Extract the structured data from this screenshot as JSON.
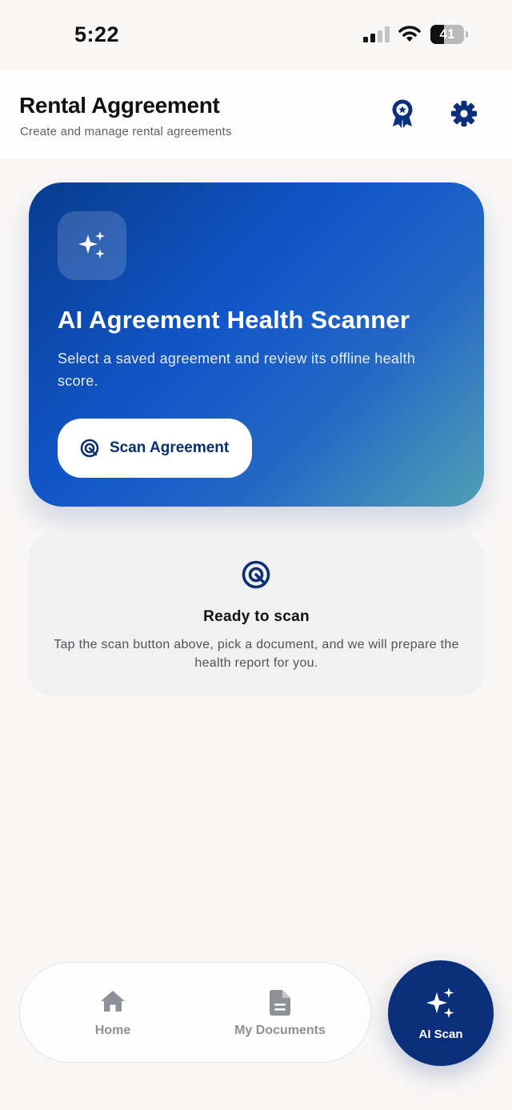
{
  "status_bar": {
    "time": "5:22",
    "battery_level": "41",
    "battery_fraction": 0.41,
    "signal_bars_active": 2,
    "signal_bars_total": 4
  },
  "header": {
    "title": "Rental Aggreement",
    "subtitle": "Create and manage rental agreements",
    "award_icon": "award-badge-icon",
    "settings_icon": "gear-icon"
  },
  "hero": {
    "icon": "sparkles-icon",
    "title": "AI Agreement Health Scanner",
    "description": "Select a saved agreement and review its offline health score.",
    "button_label": "Scan Agreement",
    "button_icon": "radar-icon"
  },
  "ready": {
    "icon": "radar-icon",
    "title": "Ready to scan",
    "description": "Tap the scan button above, pick a document, and we will prepare the health report for you."
  },
  "bottom_nav": {
    "items": [
      {
        "label": "Home",
        "icon": "home-icon"
      },
      {
        "label": "My Documents",
        "icon": "document-icon"
      }
    ],
    "fab": {
      "label": "AI Scan",
      "icon": "sparkles-icon"
    }
  },
  "colors": {
    "primary": "#0b2f7b",
    "hero_gradient_start": "#093c8e",
    "hero_gradient_mid": "#1156c9",
    "hero_gradient_end": "#519fb4",
    "nav_inactive": "#8e9098",
    "background": "#f9f7f6"
  }
}
